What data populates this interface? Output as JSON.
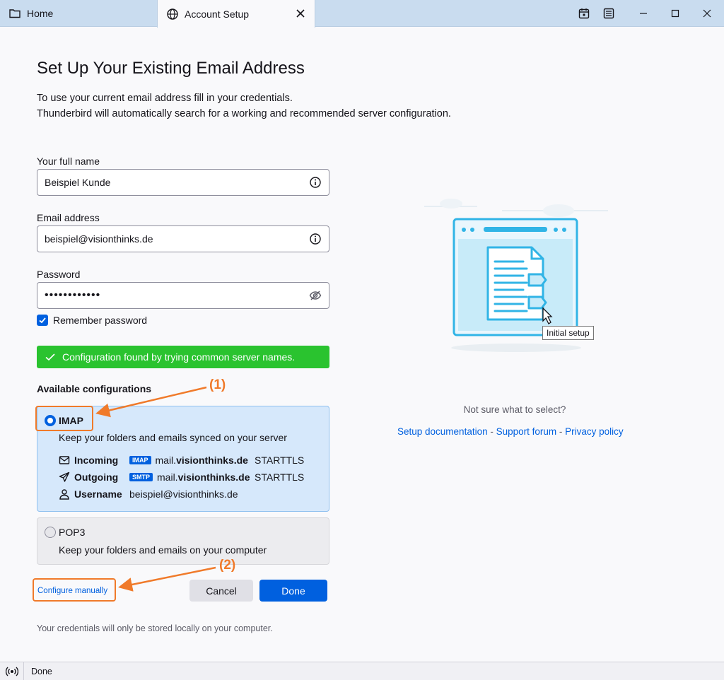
{
  "tabs": {
    "home_label": "Home",
    "account_label": "Account Setup"
  },
  "page": {
    "title": "Set Up Your Existing Email Address",
    "desc_line1": "To use your current email address fill in your credentials.",
    "desc_line2": "Thunderbird will automatically search for a working and recommended server configuration."
  },
  "form": {
    "fullname_label": "Your full name",
    "fullname_value": "Beispiel Kunde",
    "email_label": "Email address",
    "email_value": "beispiel@visionthinks.de",
    "password_label": "Password",
    "password_value": "••••••••••••",
    "remember_label": "Remember password",
    "remember_checked": true
  },
  "status": {
    "success_message": "Configuration found by trying common server names."
  },
  "configs": {
    "heading": "Available configurations",
    "imap": {
      "name": "IMAP",
      "selected": true,
      "description": "Keep your folders and emails synced on your server",
      "incoming_label": "Incoming",
      "incoming_badge": "IMAP",
      "incoming_host_prefix": "mail.",
      "incoming_host_domain": "visionthinks.de",
      "incoming_security": "STARTTLS",
      "outgoing_label": "Outgoing",
      "outgoing_badge": "SMTP",
      "outgoing_host_prefix": "mail.",
      "outgoing_host_domain": "visionthinks.de",
      "outgoing_security": "STARTTLS",
      "username_label": "Username",
      "username_value": "beispiel@visionthinks.de"
    },
    "pop3": {
      "name": "POP3",
      "selected": false,
      "description": "Keep your folders and emails on your computer"
    }
  },
  "annotations": {
    "a1": "(1)",
    "a2": "(2)"
  },
  "actions": {
    "configure_manually": "Configure manually",
    "cancel": "Cancel",
    "done": "Done"
  },
  "footnote": "Your credentials will only be stored locally on your computer.",
  "side": {
    "tooltip": "Initial setup",
    "not_sure": "Not sure what to select?",
    "link_setup": "Setup documentation",
    "link_forum": "Support forum",
    "link_privacy": "Privacy policy",
    "separator": " - "
  },
  "statusbar": {
    "text": "Done"
  },
  "colors": {
    "accent": "#0060df",
    "success": "#2ac32f",
    "annotation": "#f07a2a"
  }
}
